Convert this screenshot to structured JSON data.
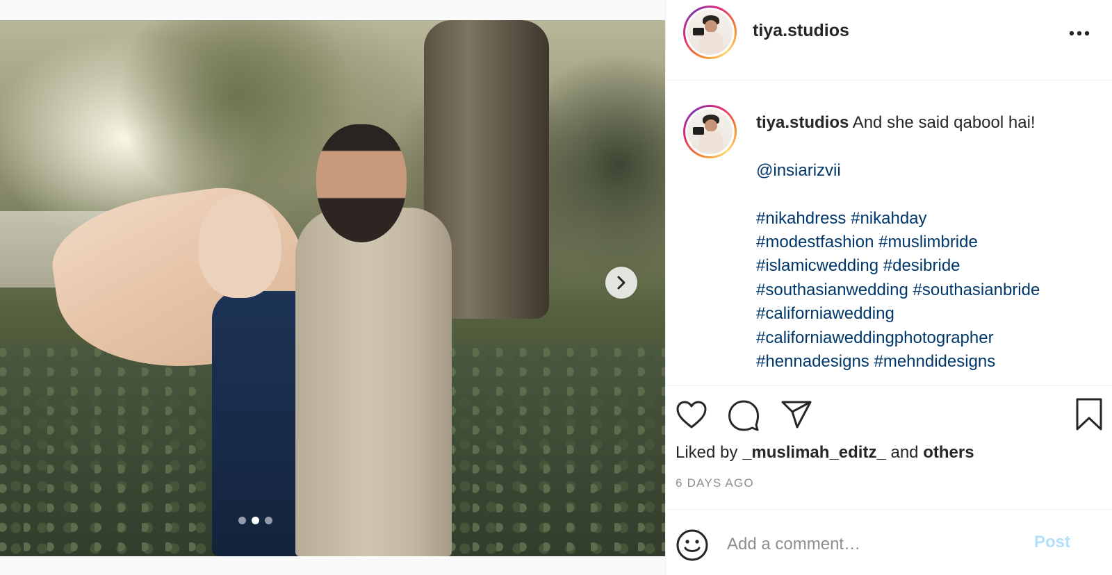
{
  "post": {
    "image_alt": "Couple embracing under trees",
    "carousel": {
      "total": 3,
      "active_index": 1
    },
    "author": {
      "username": "tiya.studios"
    }
  },
  "caption": {
    "username": "tiya.studios",
    "text": "And she said qabool hai!",
    "mention": "@insiarizvii",
    "hashtag_lines": [
      [
        "#nikahdress",
        "#nikahday"
      ],
      [
        "#modestfashion",
        "#muslimbride"
      ],
      [
        "#islamicwedding",
        "#desibride"
      ],
      [
        "#southasianwedding",
        "#southasianbride"
      ],
      [
        "#californiawedding"
      ],
      [
        "#californiaweddingphotographer"
      ],
      [
        "#hennadesigns",
        "#mehndidesigns"
      ]
    ]
  },
  "actions": {
    "icons": [
      "heart-icon",
      "comment-icon",
      "share-icon",
      "bookmark-icon"
    ],
    "liked_by_prefix": "Liked by",
    "liked_by_user": "_muslimah_editz_",
    "liked_by_and": "and",
    "liked_by_others": "others",
    "timestamp": "6 DAYS AGO"
  },
  "comment": {
    "placeholder": "Add a comment…",
    "post_label": "Post"
  },
  "colors": {
    "link": "#00376b",
    "muted": "#8e8e8e",
    "post_disabled": "#b2dffc",
    "text": "#262626"
  }
}
